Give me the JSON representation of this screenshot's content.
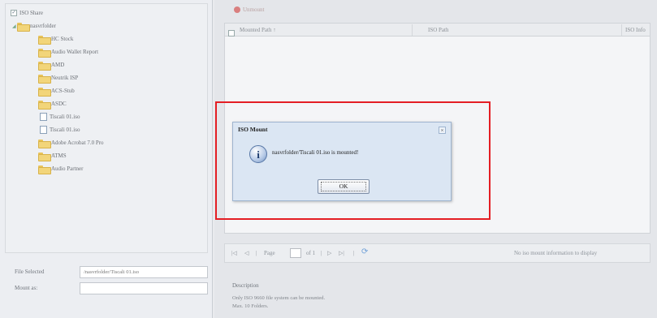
{
  "tree": {
    "root_label": "ISO Share",
    "items": [
      {
        "label": "nasvrfolder",
        "kind": "folder-open"
      },
      {
        "label": "HC Stock",
        "kind": "folder"
      },
      {
        "label": "Audio Wallet Report",
        "kind": "folder"
      },
      {
        "label": "AMD",
        "kind": "folder"
      },
      {
        "label": "Neutrik ISP",
        "kind": "folder"
      },
      {
        "label": "ACS-Stub",
        "kind": "folder"
      },
      {
        "label": "ASDC",
        "kind": "folder"
      },
      {
        "label": "Tiscali 01.iso",
        "kind": "file"
      },
      {
        "label": "Tiscali 01.iso",
        "kind": "file"
      },
      {
        "label": "Adobe Acrobat 7.0 Pro",
        "kind": "folder"
      },
      {
        "label": "ATMS",
        "kind": "folder"
      },
      {
        "label": "Audio Partner",
        "kind": "folder"
      }
    ]
  },
  "form": {
    "file_selected_label": "File Selected",
    "file_selected_value": "/nasvrfolder/Tiscali 01.iso",
    "mount_as_label": "Mount as:",
    "mount_as_value": ""
  },
  "toolbar": {
    "unmount_label": "Unmount"
  },
  "grid": {
    "columns": [
      "Mounted Path ↑",
      "ISO Path",
      "ISO Info"
    ]
  },
  "pager": {
    "page_label": "Page",
    "of_label": "of 1",
    "status": "No iso mount information to display"
  },
  "description": {
    "title": "Description",
    "lines": [
      "Only ISO 9660 file system can be mounted.",
      "Max. 10 Folders."
    ]
  },
  "dialog": {
    "title": "ISO Mount",
    "message": "nasvrfolder/Tiscali 01.iso is mounted!",
    "ok_label": "OK",
    "close_glyph": "×",
    "info_glyph": "i"
  },
  "colors": {
    "highlight": "#e41e24",
    "dialog_bg": "#dbe6f3"
  }
}
